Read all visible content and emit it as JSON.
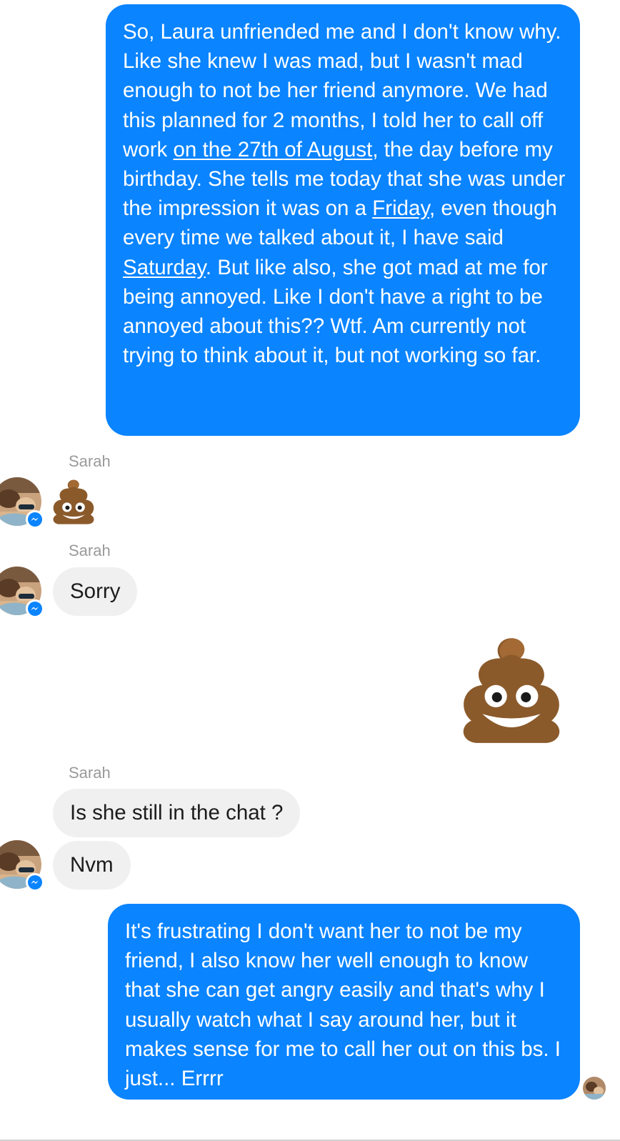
{
  "conversation": {
    "messages": [
      {
        "from": "me",
        "segments": [
          {
            "text": "So, Laura unfriended me and I don't know why. Like she knew I was mad, but I wasn't mad enough to not be her friend anymore. We had this planned for 2 months, I told her to call off work ",
            "underline": false
          },
          {
            "text": "on the 27th of August",
            "underline": true
          },
          {
            "text": ", the day before my birthday. She tells me today that she was under the impression it was on a ",
            "underline": false
          },
          {
            "text": "Friday",
            "underline": true
          },
          {
            "text": ", even though every time we talked about it, I have said ",
            "underline": false
          },
          {
            "text": "Saturday",
            "underline": true
          },
          {
            "text": ". But like also, she got mad at me for being annoyed. Like I don't have a right to be annoyed about this?? Wtf. Am currently not trying to think about it, but not working so far.",
            "underline": false
          }
        ]
      },
      {
        "from": "Sarah",
        "sender_label": "Sarah",
        "emoji": "pile-of-poo"
      },
      {
        "from": "Sarah",
        "sender_label": "Sarah",
        "text": "Sorry"
      },
      {
        "from": "me",
        "emoji": "pile-of-poo"
      },
      {
        "from": "Sarah",
        "sender_label": "Sarah",
        "text": "Is she still in the chat ?"
      },
      {
        "from": "Sarah",
        "text": "Nvm"
      },
      {
        "from": "me",
        "segments": [
          {
            "text": "It's frustrating I don't want her to not be my friend, I also know her well enough to know that she can get angry easily and that's why I usually watch what I say around her, but it makes sense for me to call her out on this bs. I just... Errrr",
            "underline": false
          }
        ]
      }
    ]
  },
  "colors": {
    "outgoing_bubble": "#0a84ff",
    "incoming_bubble": "#f0f0f0",
    "sender_label": "#9a9a9a",
    "messenger_badge": "#0a84ff"
  },
  "icons": {
    "emoji": "pile-of-poo",
    "badge": "messenger-icon"
  }
}
